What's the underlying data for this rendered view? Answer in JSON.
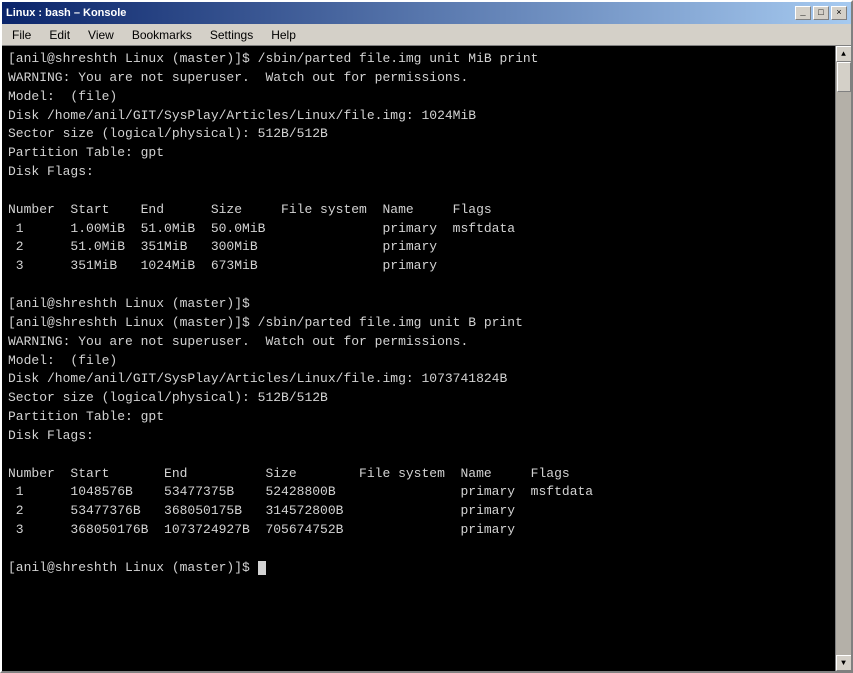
{
  "window": {
    "title": "Linux : bash – Konsole",
    "title_buttons": [
      "_",
      "□",
      "×"
    ]
  },
  "menu": {
    "items": [
      "File",
      "Edit",
      "View",
      "Bookmarks",
      "Settings",
      "Help"
    ]
  },
  "terminal": {
    "lines": [
      "[anil@shreshth Linux (master)]$ /sbin/parted file.img unit MiB print",
      "WARNING: You are not superuser.  Watch out for permissions.",
      "Model:  (file)",
      "Disk /home/anil/GIT/SysPlay/Articles/Linux/file.img: 1024MiB",
      "Sector size (logical/physical): 512B/512B",
      "Partition Table: gpt",
      "Disk Flags: ",
      "",
      "Number  Start    End      Size     File system  Name     Flags",
      " 1      1.00MiB  51.0MiB  50.0MiB               primary  msftdata",
      " 2      51.0MiB  351MiB   300MiB                primary",
      " 3      351MiB   1024MiB  673MiB                primary",
      "",
      "[anil@shreshth Linux (master)]$ ",
      "[anil@shreshth Linux (master)]$ /sbin/parted file.img unit B print",
      "WARNING: You are not superuser.  Watch out for permissions.",
      "Model:  (file)",
      "Disk /home/anil/GIT/SysPlay/Articles/Linux/file.img: 1073741824B",
      "Sector size (logical/physical): 512B/512B",
      "Partition Table: gpt",
      "Disk Flags: ",
      "",
      "Number  Start       End          Size        File system  Name     Flags",
      " 1      1048576B    53477375B    52428800B                primary  msftdata",
      " 2      53477376B   368050175B   314572800B               primary",
      " 3      368050176B  1073724927B  705674752B               primary",
      "",
      "[anil@shreshth Linux (master)]$ "
    ],
    "last_prompt": "[anil@shreshth Linux (master)]$ "
  }
}
